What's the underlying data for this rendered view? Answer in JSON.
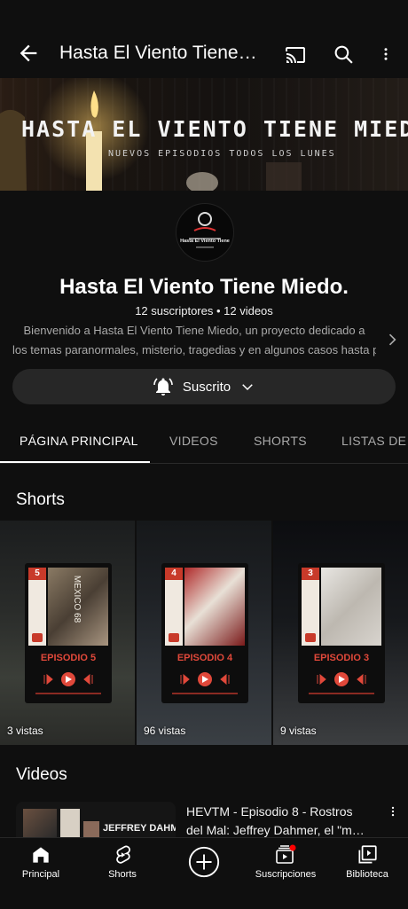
{
  "topbar": {
    "back_icon": "arrow-left-icon",
    "title": "Hasta El Viento Tiene…",
    "cast_icon": "cast-icon",
    "search_icon": "search-icon",
    "more_icon": "more-vert-icon"
  },
  "banner": {
    "title": "HASTA EL VIENTO TIENE MIEDO",
    "subtitle": "NUEVOS EPISODIOS TODOS LOS LUNES"
  },
  "channel": {
    "avatar_text": "Hasta El Viento Tiene",
    "name": "Hasta El Viento Tiene Miedo.",
    "stats": "12 suscriptores • 12 videos",
    "description_line1": "Bienvenido a Hasta El Viento Tiene Miedo, un proyecto dedicado a",
    "description_line2": "los temas paranormales, misterio, tragedias y en algunos casos hasta p…",
    "subscribe_label": "Suscrito"
  },
  "tabs": [
    {
      "label": "PÁGINA PRINCIPAL",
      "active": true
    },
    {
      "label": "VIDEOS",
      "active": false
    },
    {
      "label": "SHORTS",
      "active": false
    },
    {
      "label": "LISTAS DE R",
      "active": false
    }
  ],
  "shorts": {
    "heading": "Shorts",
    "items": [
      {
        "number": "5",
        "episode": "EPISODIO 5",
        "views": "3 vistas",
        "poster_text": "MEXICO 68"
      },
      {
        "number": "4",
        "episode": "EPISODIO 4",
        "views": "96 vistas"
      },
      {
        "number": "3",
        "episode": "EPISODIO 3",
        "views": "9 vistas"
      }
    ]
  },
  "videos": {
    "heading": "Videos",
    "items": [
      {
        "title_line1": "HEVTM - Episodio 8 - Rostros",
        "title_line2": "del Mal: Jeffrey Dahmer, el \"m…",
        "thumb_text": "JEFFREY DAHMER EL"
      }
    ]
  },
  "bottomnav": [
    {
      "label": "Principal",
      "icon": "home-icon"
    },
    {
      "label": "Shorts",
      "icon": "shorts-icon"
    },
    {
      "label": "",
      "icon": "create-icon"
    },
    {
      "label": "Suscripciones",
      "icon": "subscriptions-icon"
    },
    {
      "label": "Biblioteca",
      "icon": "library-icon"
    }
  ],
  "colors": {
    "background": "#0f0f0f",
    "accent_red": "#ff0000",
    "poster_red": "#e0483a"
  }
}
